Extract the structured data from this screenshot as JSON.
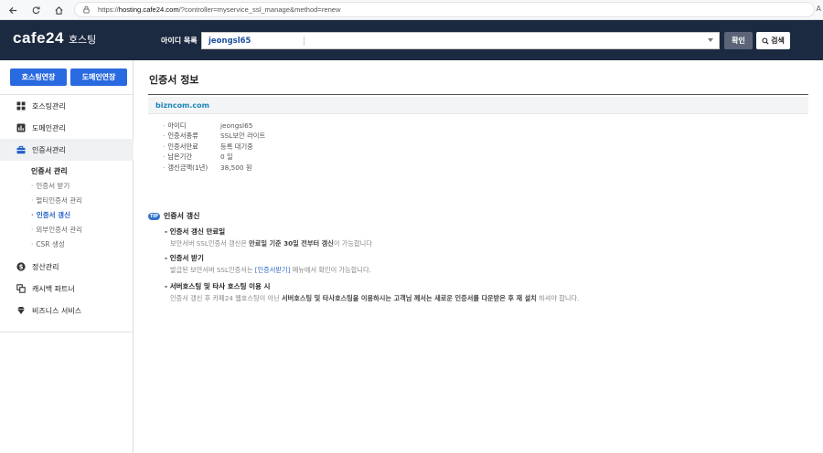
{
  "browser": {
    "url_prefix": "https://",
    "url_host": "hosting.cafe24.com",
    "url_path": "/?controller=myservice_ssl_manage&method=renew",
    "aa_label": "A"
  },
  "header": {
    "logo_mark": "cafe24",
    "logo_sub": "호스팅",
    "id_label": "아이디 목록",
    "id_value": "jeongsl65",
    "confirm_label": "확인",
    "search_label": "검색"
  },
  "sidebar": {
    "btn_hosting": "호스팅연장",
    "btn_domain": "도메인연장",
    "menu": [
      {
        "label": "호스팅관리",
        "icon": "grid-icon"
      },
      {
        "label": "도메인관리",
        "icon": "bar-chart-icon"
      },
      {
        "label": "인증서관리",
        "icon": "briefcase-icon"
      },
      {
        "label": "정산관리",
        "icon": "dollar-icon"
      },
      {
        "label": "캐시백 파트너",
        "icon": "copy-icon"
      },
      {
        "label": "비즈니스 서비스",
        "icon": "diamond-icon"
      }
    ],
    "sub_head": "인증서 관리",
    "sub_items": [
      "인증서 받기",
      "멀티인증서 관리",
      "인증서 갱신",
      "외부인증서 관리",
      "CSR 생성"
    ]
  },
  "main": {
    "title": "인증서 정보",
    "domain": "bizncom.com",
    "info": [
      {
        "key": "아이디",
        "value": "jeongsl65"
      },
      {
        "key": "인증서종류",
        "value": "SSL보안 라이트"
      },
      {
        "key": "인증서만료",
        "value": "등록 대기중"
      },
      {
        "key": "남은기간",
        "value": "0 일"
      },
      {
        "key": "갱신금액(1년)",
        "value": "38,500 원"
      }
    ],
    "tip_badge": "TIP",
    "tip_title": "인증서 갱신",
    "tips": [
      {
        "title": "인증서 갱신 만료일",
        "desc_a": "보안서버 SSL인증서 갱신은 ",
        "desc_b": "만료일 기준 30일 전부터 갱신",
        "desc_c": "이 가능합니다"
      },
      {
        "title": "인증서 받기",
        "desc_a": "발급된 보안서버 SSL인증서는 ",
        "desc_b": "[인증서받기]",
        "desc_c": " 메뉴에서 확인이 가능합니다."
      },
      {
        "title": "서버호스팅 및 타사 호스팅 이용 시",
        "desc_a": "인증서 갱신 후 카페24 웹호스팅이 아닌 ",
        "desc_b": "서버호스팅 및 타사호스팅을 이용하시는 고객님 께서는 새로운 인증서를 다운받은 후 재 설치",
        "desc_c": " 하셔야 합니다."
      }
    ]
  }
}
